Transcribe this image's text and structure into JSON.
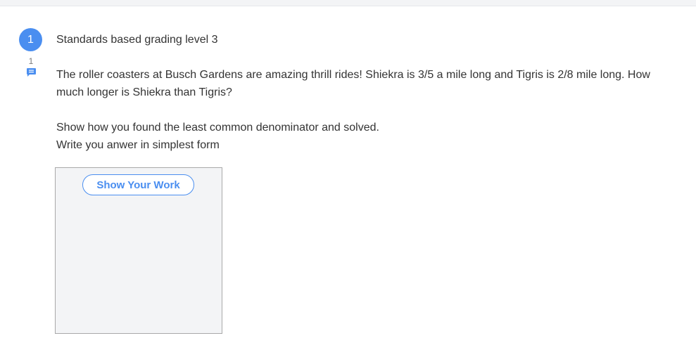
{
  "header": {
    "accent_color": "#4a8ef0"
  },
  "question": {
    "number": "1",
    "comment_count": "1",
    "comment_icon": "comment-icon",
    "title": "Standards based grading level 3",
    "prompt_lines": [
      "The roller coasters at Busch Gardens are amazing thrill rides!  Shiekra is 3/5 a mile long and Tigris is 2/8 mile long. How much longer is Shiekra than Tigris?"
    ],
    "instructions": [
      "Show how you found the least common denominator and solved.",
      "Write you anwer in simplest form"
    ]
  },
  "work_area": {
    "button_label": "Show Your Work"
  }
}
